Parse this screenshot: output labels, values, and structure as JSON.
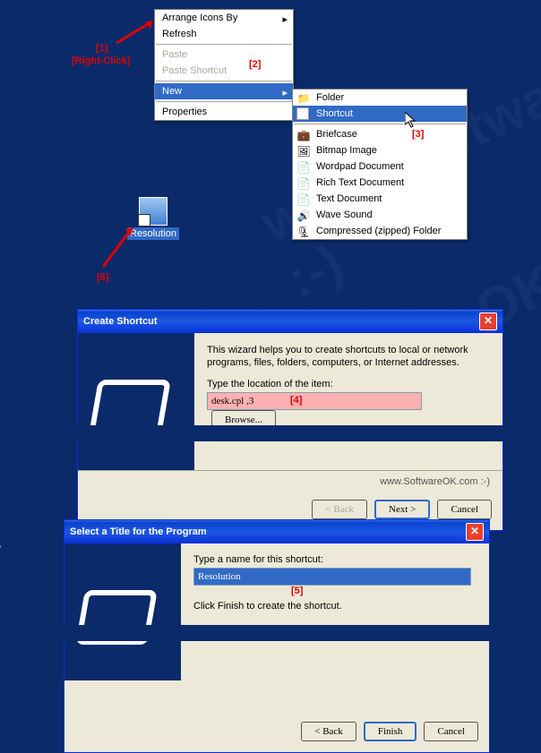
{
  "watermark": "www.SoftwareOK.com :-)",
  "context_menu": {
    "arrange": "Arrange Icons By",
    "refresh": "Refresh",
    "paste": "Paste",
    "paste_shortcut": "Paste Shortcut",
    "new": "New",
    "properties": "Properties"
  },
  "submenu": {
    "folder": "Folder",
    "shortcut": "Shortcut",
    "briefcase": "Briefcase",
    "bitmap": "Bitmap Image",
    "wordpad": "Wordpad Document",
    "rtf": "Rich Text Document",
    "txt": "Text Document",
    "wav": "Wave Sound",
    "zip": "Compressed (zipped) Folder"
  },
  "desktop_icon": "Resolution",
  "annotations": {
    "a1": "[1]",
    "a1b": "[Right-Click]",
    "a2": "[2]",
    "a3": "[3]",
    "a4": "[4]",
    "a5": "[5]",
    "a6": "[6]"
  },
  "dialog1": {
    "title": "Create Shortcut",
    "text": "This wizard helps you to create shortcuts to local or network programs, files, folders, computers, or Internet addresses.",
    "label": "Type the location of the item:",
    "value": "desk.cpl ,3",
    "browse": "Browse...",
    "footer": "www.SoftwareOK.com :-)",
    "back": "< Back",
    "next": "Next >",
    "cancel": "Cancel"
  },
  "dialog2": {
    "title": "Select a Title for the Program",
    "label": "Type a name for this shortcut:",
    "value": "Resolution",
    "text2": "Click Finish to create the shortcut.",
    "back": "< Back",
    "finish": "Finish",
    "cancel": "Cancel"
  }
}
